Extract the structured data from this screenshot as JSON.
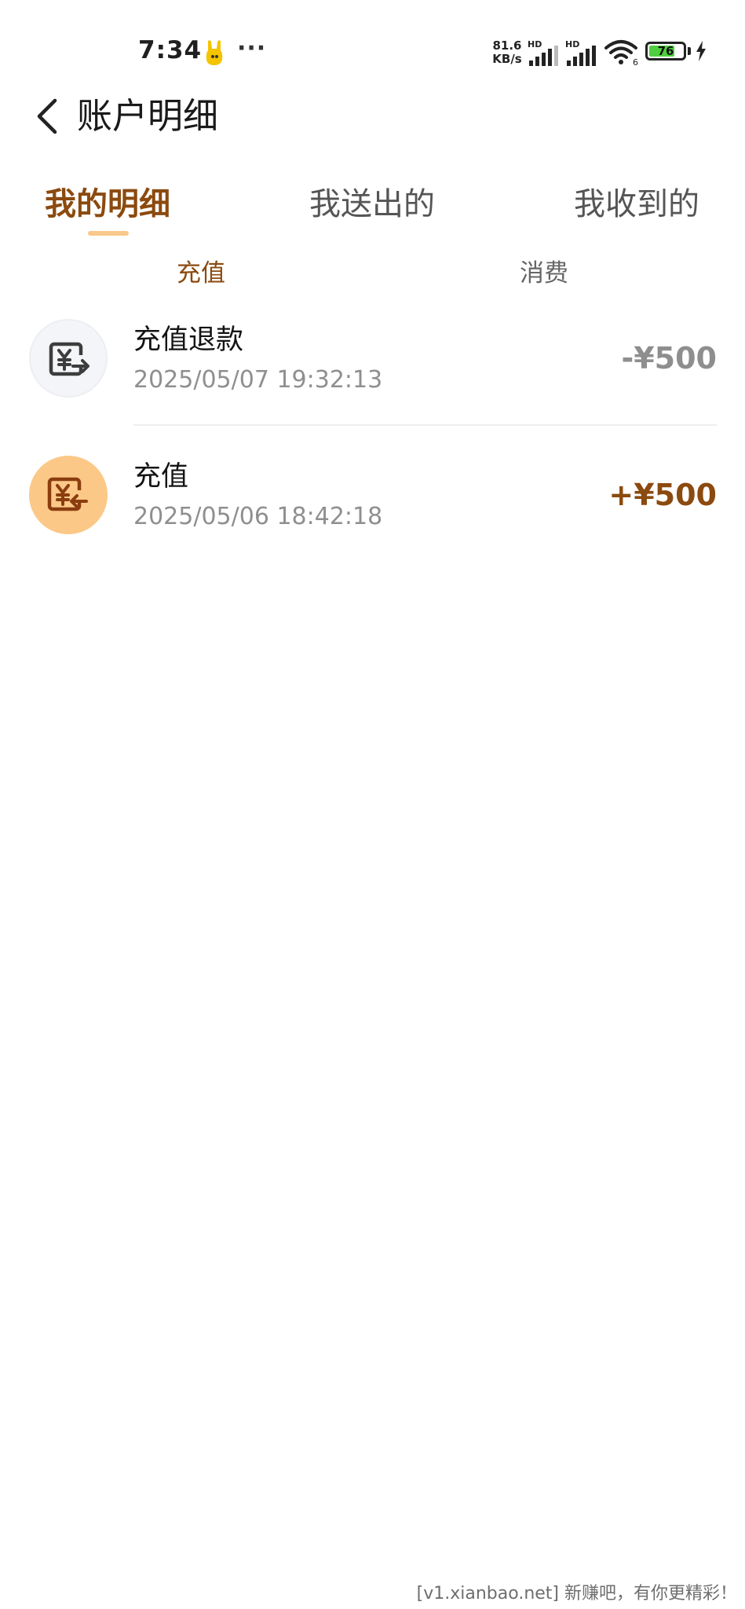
{
  "status_bar": {
    "time": "7:34",
    "more": "···",
    "net_speed_value": "81.6",
    "net_speed_unit": "KB/s",
    "signal_1_label": "HD",
    "signal_2_label": "HD",
    "wifi_badge": "6",
    "battery_level": "76",
    "battery_fraction": 0.76,
    "battery_color": "#4fcf3f"
  },
  "header": {
    "title": "账户明细"
  },
  "tabs": [
    {
      "label": "我的明细",
      "active": true
    },
    {
      "label": "我送出的",
      "active": false
    },
    {
      "label": "我收到的",
      "active": false
    }
  ],
  "sub_tabs": [
    {
      "label": "充值",
      "active": true
    },
    {
      "label": "消费",
      "active": false
    }
  ],
  "records": [
    {
      "title": "充值退款",
      "time": "2025/05/07 19:32:13",
      "amount": "-¥500",
      "icon": "refund-yen-icon",
      "amount_color": "#8e8e8e",
      "icon_bg": "#f4f5f8"
    },
    {
      "title": "充值",
      "time": "2025/05/06 18:42:18",
      "amount": "+¥500",
      "icon": "recharge-yen-icon",
      "amount_color": "#8b4a0f",
      "icon_bg": "#fbc887"
    }
  ],
  "colors": {
    "accent": "#8b4a0f",
    "indicator": "#f8c98a"
  },
  "watermark": "[v1.xianbao.net] 新赚吧，有你更精彩！"
}
